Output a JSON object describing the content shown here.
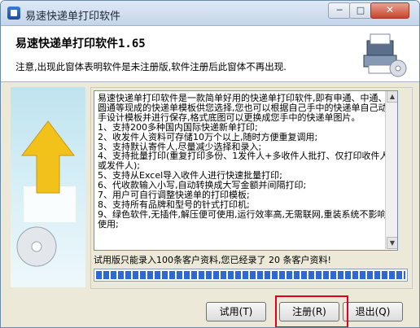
{
  "window": {
    "title": "易速快递单打印软件",
    "controls": {
      "minimize": "─",
      "maximize": "□",
      "close": "✕"
    }
  },
  "banner": {
    "title": "易速快递单打印软件1.65",
    "notice": "注意,出现此窗体表明软件是未注册版,软件注册后此窗体不再出现."
  },
  "info": {
    "text": "易速快递单打印软件是一款简单好用的快递单打印软件,即有申通、中通、圆通等现成的快递单模板供您选择,您也可以根据自己手中的快递单自己动手设计模板并进行保存,格式底图可以更换成您手中的快递单图片。\n1、支持200多种国内国际快递新单打印;\n2、收发件人资料可存储10万个以上,随时方便重复调用;\n3、支持默认寄件人,尽量减少选择和录入;\n4、支持批量打印(重复打印多份、1发件人+多收件人批打、仅打印收件人或发件人);\n5、支持从Excel导入收件人进行快速批量打印;\n6、代收款输入小写,自动转换成大写金额并间隔打印;\n7、用户可自行调整快递单的打印模板;\n8、支持所有品牌和型号的针式打印机;\n9、绿色软件,无插件,解压便可使用,运行效率高,无需联网,重装系统不影响使用;"
  },
  "status": {
    "text": "试用版只能录入100条客户资料,您已经录了 20 条客户资料!",
    "progress": 1.0
  },
  "buttons": {
    "trial": "试用(T)",
    "register": "注册(R)",
    "exit": "退出(Q)"
  },
  "colors": {
    "progress": "#2c69d8",
    "highlight": "#e3001b"
  }
}
